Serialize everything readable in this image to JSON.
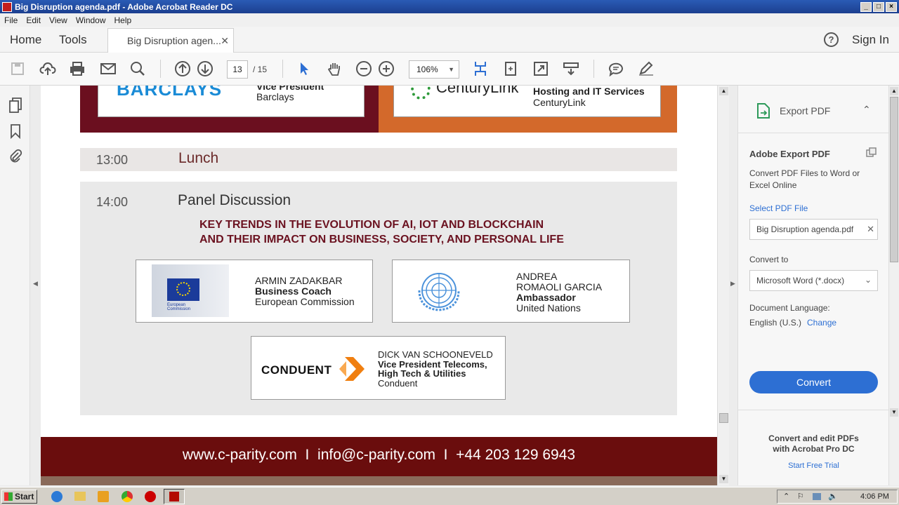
{
  "window": {
    "title": "Big Disruption agenda.pdf - Adobe Acrobat Reader DC"
  },
  "menu": [
    "File",
    "Edit",
    "View",
    "Window",
    "Help"
  ],
  "tabs": {
    "home": "Home",
    "tools": "Tools",
    "document": "Big Disruption agen...",
    "signin": "Sign In"
  },
  "toolbar": {
    "page_current": "13",
    "page_total": "/ 15",
    "zoom": "106%"
  },
  "document": {
    "speaker_top_left_role": "Vice President",
    "speaker_top_left_company": "Barclays",
    "barclays_logo": "BARCLAYS",
    "speaker_top_right_role": "Hosting and IT Services",
    "speaker_top_right_company": "CenturyLink",
    "centurylink_logo": "CenturyLink",
    "lunch_time": "13:00",
    "lunch_label": "Lunch",
    "panel_time": "14:00",
    "panel_label": "Panel Discussion",
    "panel_topic_line1": "KEY TRENDS IN THE EVOLUTION OF AI, IOT AND BLOCKCHAIN",
    "panel_topic_line2": "AND THEIR IMPACT ON BUSINESS, SOCIETY, AND PERSONAL LIFE",
    "speaker1": {
      "name": "ARMIN ZADAKBAR",
      "role": "Business Coach",
      "org": "European Commission",
      "logo_text": "European Commission"
    },
    "speaker2": {
      "name1": "ANDREA",
      "name2": "ROMAOLI GARCIA",
      "role": "Ambassador",
      "org": "United Nations"
    },
    "speaker3": {
      "name": "DICK VAN SCHOONEVELD",
      "role1": "Vice President Telecoms,",
      "role2": "High Tech & Utilities",
      "org": "Conduent",
      "logo_text": "CONDUENT"
    },
    "footer": "www.c-parity.com  I  info@c-parity.com  I  +44 203 129 6943"
  },
  "rightpanel": {
    "header": "Export PDF",
    "title": "Adobe Export PDF",
    "desc": "Convert PDF Files to Word or Excel Online",
    "select_label": "Select PDF File",
    "file_name": "Big Disruption agenda.pdf",
    "convert_to_label": "Convert to",
    "convert_to_value": "Microsoft Word (*.docx)",
    "doc_lang_label": "Document Language:",
    "doc_lang_value": "English (U.S.)",
    "change_link": "Change",
    "convert_button": "Convert",
    "promo_line1": "Convert and edit PDFs",
    "promo_line2": "with Acrobat Pro DC",
    "trial_link": "Start Free Trial"
  },
  "taskbar": {
    "start": "Start",
    "clock": "4:06 PM"
  },
  "colors": {
    "accent_blue": "#2d6fd3",
    "maroon": "#6b0f1f",
    "orange": "#d3692b",
    "footer_red": "#6a0d0d"
  }
}
